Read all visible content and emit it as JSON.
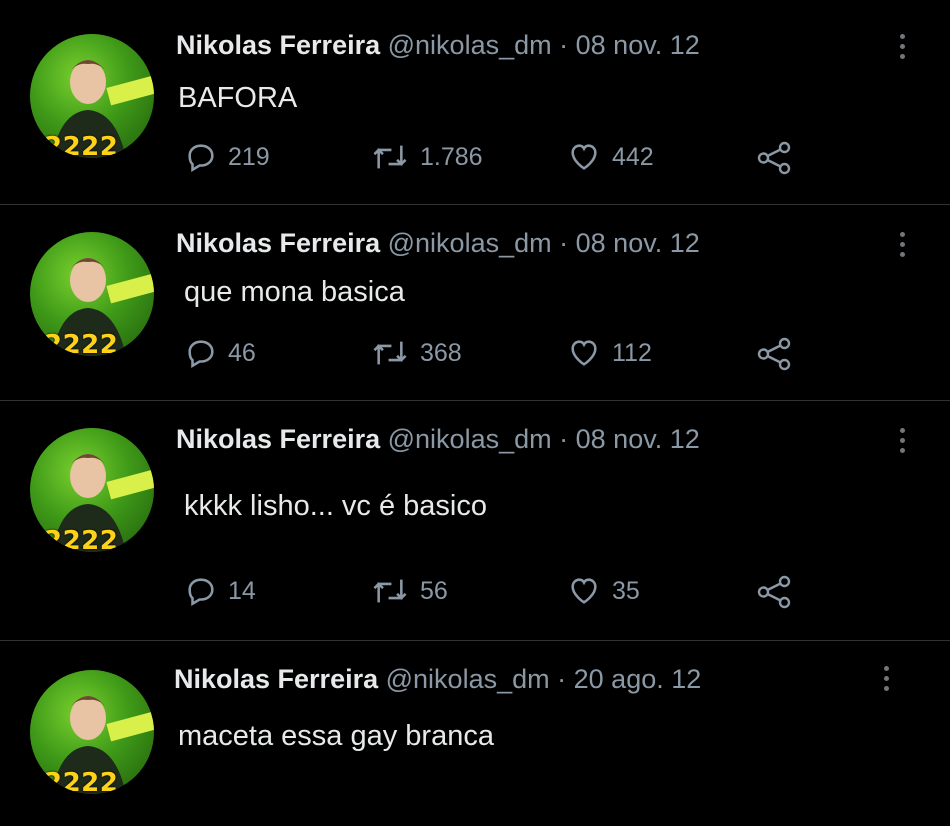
{
  "author": {
    "name": "Nikolas Ferreira",
    "handle": "@nikolas_dm",
    "avatar_badge": "2222"
  },
  "colors": {
    "background": "#000000",
    "text": "#e7e9ea",
    "muted": "#8b98a5",
    "badge": "#ffd21a",
    "avatar_green": "#3f9a18"
  },
  "separator": "·",
  "tweets": [
    {
      "date": "08 nov. 12",
      "text": "BAFORA",
      "replies": "219",
      "retweets": "1.786",
      "likes": "442"
    },
    {
      "date": "08 nov. 12",
      "text": "que mona basica",
      "replies": "46",
      "retweets": "368",
      "likes": "112"
    },
    {
      "date": "08 nov. 12",
      "text": "kkkk lisho... vc é basico",
      "replies": "14",
      "retweets": "56",
      "likes": "35"
    },
    {
      "date": "20 ago. 12",
      "text": "maceta essa gay branca"
    }
  ],
  "icons": {
    "reply": "reply-icon",
    "retweet": "retweet-icon",
    "like": "heart-icon",
    "share": "share-icon",
    "more": "more-vertical-icon"
  }
}
